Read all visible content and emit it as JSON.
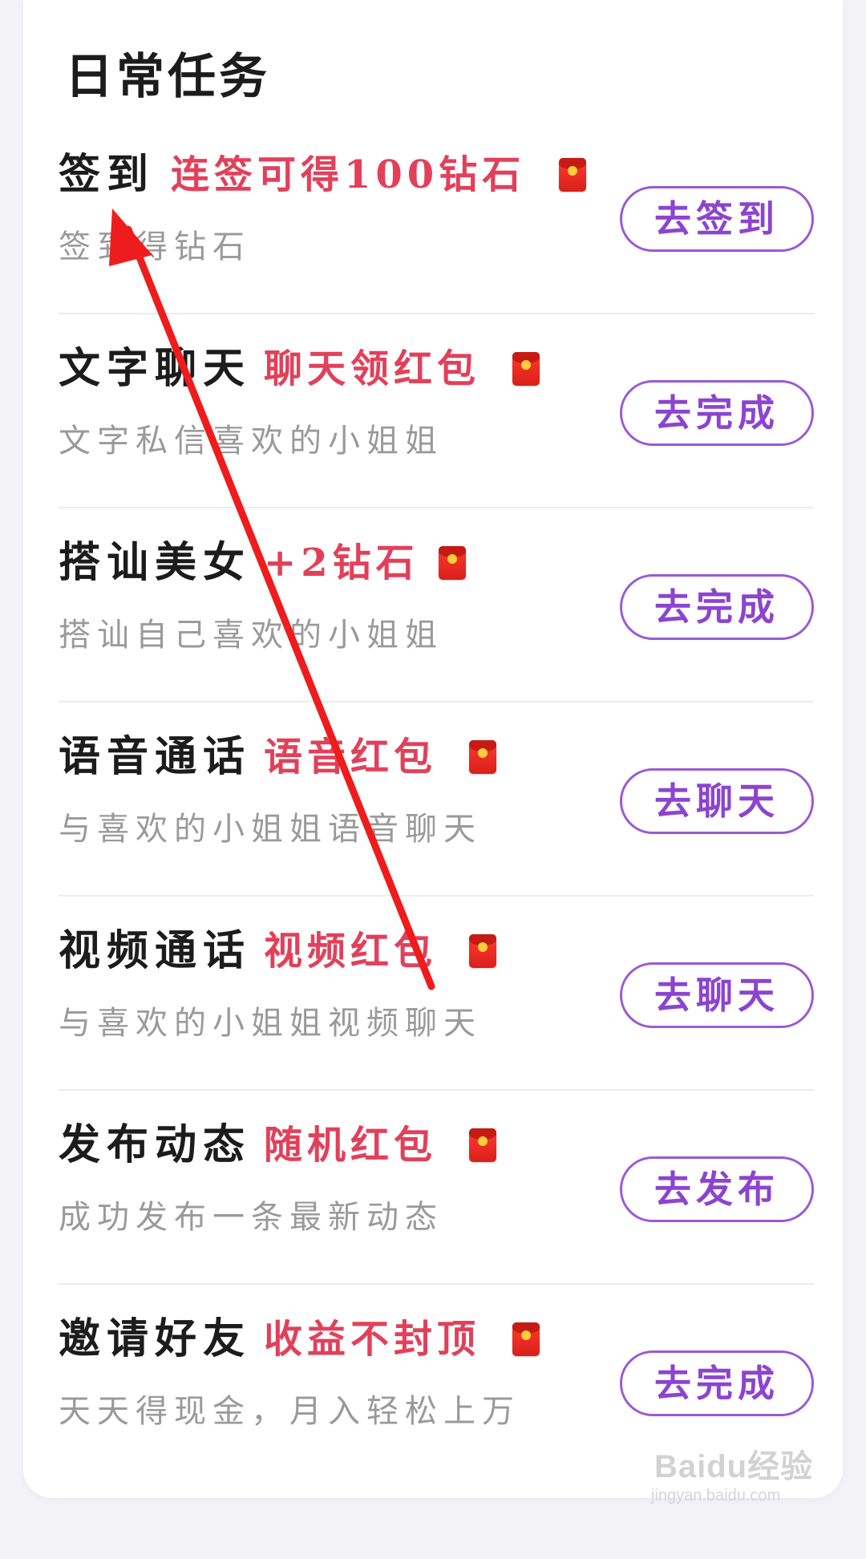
{
  "section": {
    "title": "日常任务"
  },
  "tasks": [
    {
      "name": "签到",
      "reward": "连签可得100钻石",
      "description": "签到得钻石",
      "button": "去签到",
      "icon": "red-envelope-icon"
    },
    {
      "name": "文字聊天",
      "reward": "聊天领红包",
      "description": "文字私信喜欢的小姐姐",
      "button": "去完成",
      "icon": "red-envelope-icon"
    },
    {
      "name": "搭讪美女",
      "reward": "+2钻石",
      "description": "搭讪自己喜欢的小姐姐",
      "button": "去完成",
      "icon": "red-envelope-icon"
    },
    {
      "name": "语音通话",
      "reward": "语音红包",
      "description": "与喜欢的小姐姐语音聊天",
      "button": "去聊天",
      "icon": "red-envelope-icon"
    },
    {
      "name": "视频通话",
      "reward": "视频红包",
      "description": "与喜欢的小姐姐视频聊天",
      "button": "去聊天",
      "icon": "red-envelope-icon"
    },
    {
      "name": "发布动态",
      "reward": "随机红包",
      "description": "成功发布一条最新动态",
      "button": "去发布",
      "icon": "red-envelope-icon"
    },
    {
      "name": "邀请好友",
      "reward": "收益不封顶",
      "description": "天天得现金，月入轻松上万",
      "button": "去完成",
      "icon": "red-envelope-icon"
    }
  ],
  "colors": {
    "page_background": "#f3f3f7",
    "card_background": "#ffffff",
    "title_text": "#1c1c1c",
    "reward_text": "#e2405a",
    "description_text": "#9a9a9a",
    "button_border": "#9b59d6",
    "button_text": "#8c44d0",
    "annotation_arrow": "#ee1c1c"
  },
  "watermark": {
    "brand": "Baidu经验",
    "url": "jingyan.baidu.com"
  }
}
